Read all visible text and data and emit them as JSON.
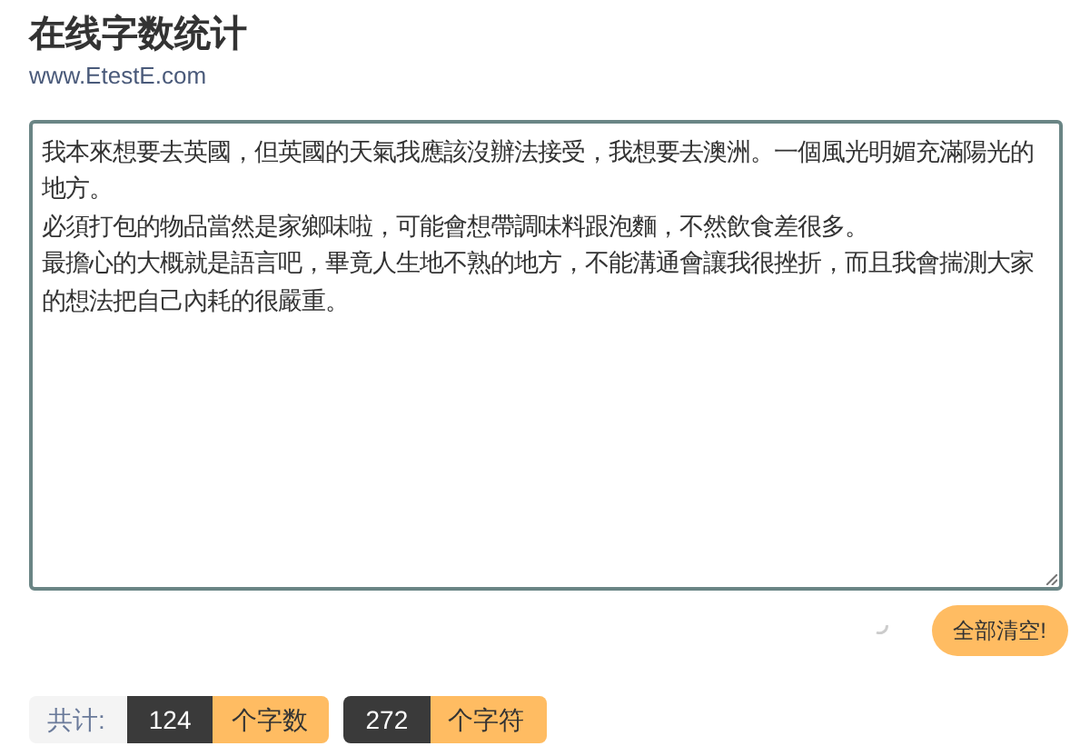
{
  "header": {
    "title": "在线字数统计",
    "subtitle": "www.EtestE.com"
  },
  "editor": {
    "paragraphs": [
      "我本來想要去英國，但英國的天氣我應該沒辦法接受，我想要去澳洲。一個風光明媚充滿陽光的地方。",
      "必須打包的物品當然是家鄉味啦，可能會想帶調味料跟泡麵，不然飲食差很多。",
      "最擔心的大概就是語言吧，畢竟人生地不熟的地方，不能溝通會讓我很挫折，而且我會揣測大家的想法把自己內耗的很嚴重。"
    ]
  },
  "clear_button": {
    "label": "全部清空!"
  },
  "stats": {
    "label": "共计:",
    "counts": [
      {
        "value": "124",
        "unit": "个字数"
      },
      {
        "value": "272",
        "unit": "个字符"
      }
    ]
  }
}
